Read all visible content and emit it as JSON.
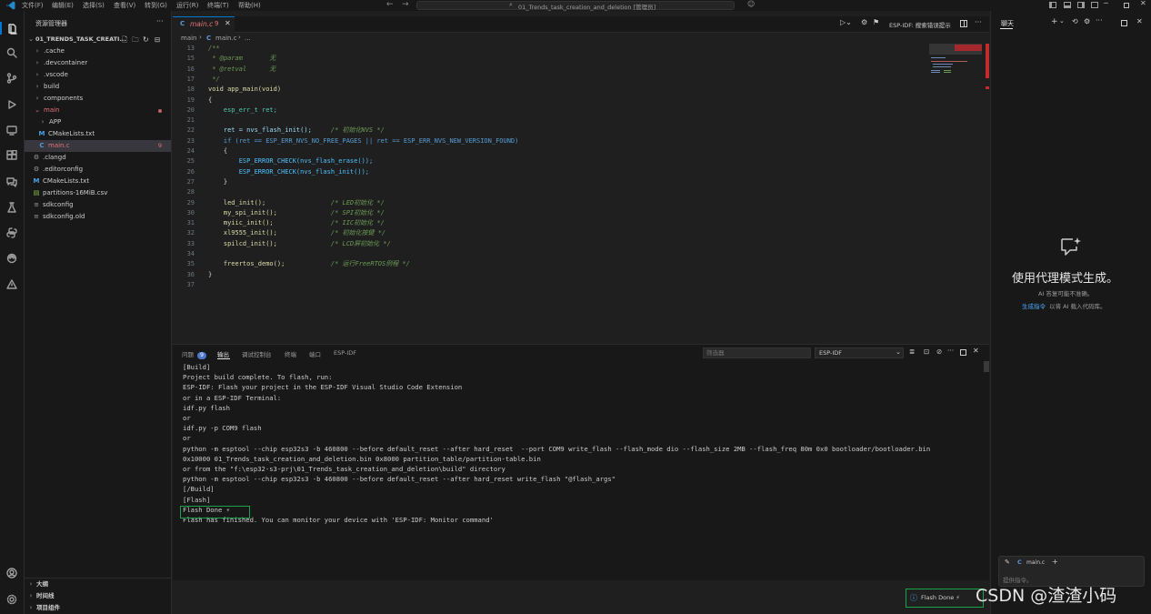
{
  "titlebar": {
    "menu": [
      "文件(F)",
      "编辑(E)",
      "选择(S)",
      "查看(V)",
      "转到(G)",
      "运行(R)",
      "终端(T)",
      "帮助(H)"
    ],
    "search": "01_Trends_task_creation_and_deletion [管理员]"
  },
  "explorer": {
    "header": "资源管理器",
    "more": "···",
    "root": "01_TRENDS_TASK_CREATI...",
    "items": [
      {
        "label": ".cache",
        "chev": "›"
      },
      {
        "label": ".devcontainer",
        "chev": "›"
      },
      {
        "label": ".vscode",
        "chev": "›"
      },
      {
        "label": "build",
        "chev": "›"
      },
      {
        "label": "components",
        "chev": "›"
      },
      {
        "label": "main",
        "chev": "⌄"
      },
      {
        "label": "APP",
        "chev": "›"
      },
      {
        "label": "CMakeLists.txt",
        "icon": "M"
      },
      {
        "label": "main.c",
        "icon": "C",
        "badge": "9"
      },
      {
        "label": ".clangd",
        "icon": "⚙"
      },
      {
        "label": ".editorconfig",
        "icon": "⚙"
      },
      {
        "label": "CMakeLists.txt",
        "icon": "M"
      },
      {
        "label": "partitions-16MiB.csv",
        "icon": "▤"
      },
      {
        "label": "sdkconfig",
        "icon": "≡"
      },
      {
        "label": "sdkconfig.old",
        "icon": "≡"
      }
    ],
    "bottom": [
      "大纲",
      "时间线",
      "项目组件"
    ]
  },
  "editor": {
    "tab": {
      "icon": "C",
      "label": "main.c",
      "badge": "9"
    },
    "breadcrumb": {
      "folder": "main",
      "icon": "C",
      "file": "main.c",
      "rest": "..."
    },
    "toolbar_label": "ESP-IDF: 搜索错误提示",
    "lines": [
      {
        "n": "13",
        "t": "/**"
      },
      {
        "n": "15",
        "t": " * @param       无"
      },
      {
        "n": "16",
        "t": " * @retval      无"
      },
      {
        "n": "17",
        "t": " */"
      },
      {
        "n": "18",
        "t": "void app_main(void)"
      },
      {
        "n": "19",
        "t": "{"
      },
      {
        "n": "20",
        "t": "    esp_err_t ret;"
      },
      {
        "n": "21",
        "t": ""
      },
      {
        "n": "22",
        "t": "    ret = nvs_flash_init();     /* 初始化NVS */"
      },
      {
        "n": "23",
        "t": "    if (ret == ESP_ERR_NVS_NO_FREE_PAGES || ret == ESP_ERR_NVS_NEW_VERSION_FOUND)"
      },
      {
        "n": "24",
        "t": "    {"
      },
      {
        "n": "25",
        "t": "        ESP_ERROR_CHECK(nvs_flash_erase());"
      },
      {
        "n": "26",
        "t": "        ESP_ERROR_CHECK(nvs_flash_init());"
      },
      {
        "n": "27",
        "t": "    }"
      },
      {
        "n": "28",
        "t": ""
      },
      {
        "n": "29",
        "t": "    led_init();                 /* LED初始化 */"
      },
      {
        "n": "30",
        "t": "    my_spi_init();              /* SPI初始化 */"
      },
      {
        "n": "31",
        "t": "    myiic_init();               /* IIC初始化 */"
      },
      {
        "n": "32",
        "t": "    xl9555_init();              /* 初始化按键 */"
      },
      {
        "n": "33",
        "t": "    spilcd_init();              /* LCD屏初始化 */"
      },
      {
        "n": "34",
        "t": ""
      },
      {
        "n": "35",
        "t": "    freertos_demo();            /* 运行FreeRTOS例程 */"
      },
      {
        "n": "36",
        "t": "}"
      },
      {
        "n": "37",
        "t": ""
      }
    ]
  },
  "panel": {
    "tabs": [
      {
        "label": "问题",
        "badge": "9"
      },
      {
        "label": "输出"
      },
      {
        "label": "调试控制台"
      },
      {
        "label": "终端"
      },
      {
        "label": "端口"
      },
      {
        "label": "ESP-IDF"
      }
    ],
    "filter_placeholder": "筛选器",
    "channel": "ESP-IDF",
    "output": [
      "[Build]",
      "Project build complete. To flash, run:",
      "ESP-IDF: Flash your project in the ESP-IDF Visual Studio Code Extension",
      "or in a ESP-IDF Terminal:",
      "idf.py flash",
      "or",
      "idf.py -p COM9 flash",
      "or",
      "python -m esptool --chip esp32s3 -b 460800 --before default_reset --after hard_reset  --port COM9 write_flash --flash_mode dio --flash_size 2MB --flash_freq 80m 0x0 bootloader/bootloader.bin",
      "0x10000 01_Trends_task_creation_and_deletion.bin 0x8000 partition_table/partition-table.bin",
      "or from the \"f:\\esp32-s3-prj\\01_Trends_task_creation_and_deletion\\build\" directory",
      "python -m esptool --chip esp32s3 -b 460800 --before default_reset --after hard_reset write_flash \"@flash_args\"",
      "[/Build]",
      "[Flash]",
      "Flash Done ⚡",
      "Flash has finished. You can monitor your device with 'ESP-IDF: Monitor command'"
    ]
  },
  "chat": {
    "title": "聊天",
    "heading": "使用代理模式生成。",
    "subtext": "AI 答复可能不准确。",
    "link": "生成指令",
    "link_rest": "以将 AI 载入代码库。",
    "attachment": {
      "icon": "C",
      "label": "main.c",
      "add": "+"
    },
    "input_placeholder": "提供指令。"
  },
  "notification": {
    "text": "Flash Done ⚡"
  },
  "watermark": "CSDN @渣渣小码"
}
